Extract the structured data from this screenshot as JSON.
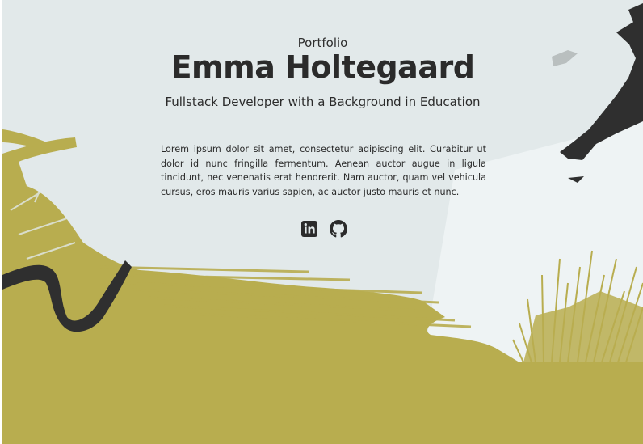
{
  "hero": {
    "kicker": "Portfolio",
    "name": "Emma Holtegaard",
    "tagline": "Fullstack Developer with a Background in Education",
    "bio": "Lorem ipsum dolor sit amet, consectetur adipiscing elit. Curabitur ut dolor id nunc fringilla fermentum. Aenean auctor augue in ligula tincidunt, nec venenatis erat hendrerit. Nam auctor, quam vel vehicula cursus, eros mauris varius sapien, ac auctor justo mauris et nunc."
  },
  "socials": [
    {
      "icon": "linkedin-icon"
    },
    {
      "icon": "github-icon"
    }
  ],
  "colors": {
    "background_light": "#e2e9ea",
    "accent_olive": "#b8ad4f",
    "ink": "#2b2b2b"
  }
}
